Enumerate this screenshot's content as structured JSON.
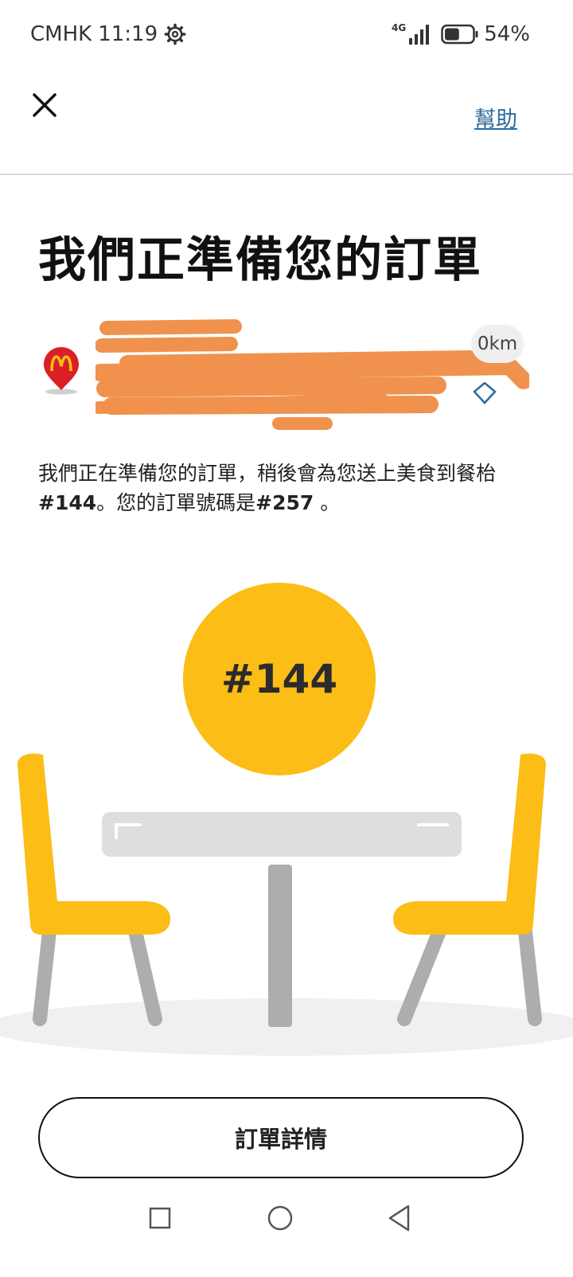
{
  "status_bar": {
    "carrier": "CMHK",
    "time": "11:19",
    "network": "4G",
    "battery": "54%",
    "battery_level": 0.54
  },
  "nav": {
    "help_label": "幫助"
  },
  "page_title": "我們正準備您的訂單",
  "store": {
    "distance": "0km"
  },
  "description": {
    "part1": "我們正在準備您的訂單，稍後會為您送上美食到餐枱",
    "table": "#144",
    "part2": "。您的訂單號碼是",
    "order": "#257",
    "part3": " 。"
  },
  "table_number": "#144",
  "order_details_label": "訂單詳情",
  "colors": {
    "accent_yellow": "#fbbd16",
    "link_blue": "#2b6c9c",
    "mcd_red": "#da1f26",
    "redaction_orange": "#f0924d"
  },
  "icons": {
    "close": "close-icon",
    "settings": "gear-icon",
    "store": "mcdonalds-location-pin-icon",
    "navigate": "navigate-icon"
  }
}
